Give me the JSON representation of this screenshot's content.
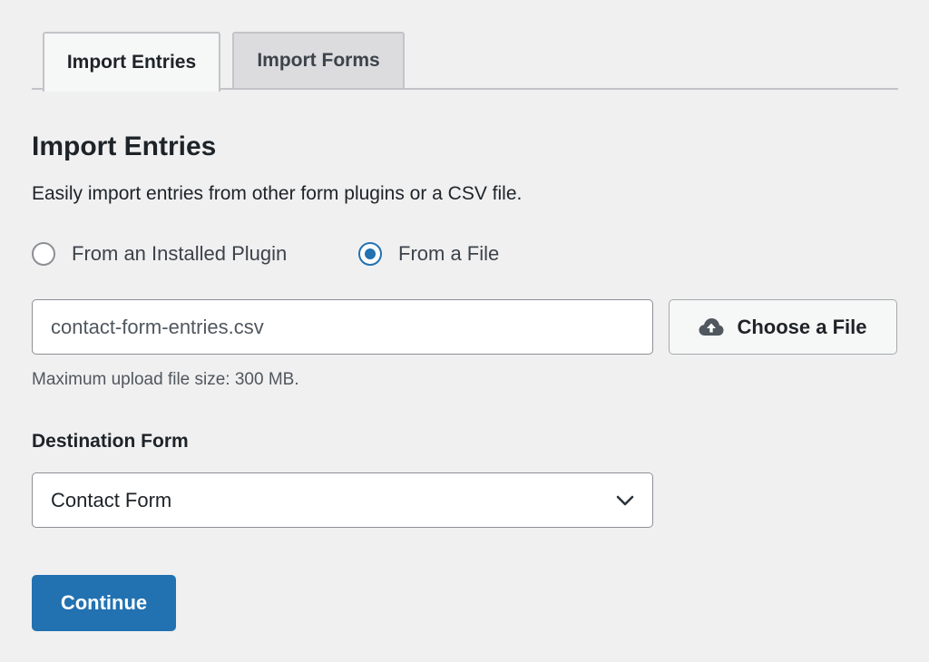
{
  "tabs": [
    {
      "label": "Import Entries",
      "active": true
    },
    {
      "label": "Import Forms",
      "active": false
    }
  ],
  "section": {
    "title": "Import Entries",
    "description": "Easily import entries from other form plugins or a CSV file."
  },
  "source_options": [
    {
      "label": "From an Installed Plugin",
      "selected": false
    },
    {
      "label": "From a File",
      "selected": true
    }
  ],
  "file_upload": {
    "value": "contact-form-entries.csv",
    "button_label": "Choose a File",
    "button_icon": "cloud-upload-icon",
    "help_text": "Maximum upload file size: 300 MB."
  },
  "destination": {
    "label": "Destination Form",
    "selected": "Contact Form",
    "icon": "chevron-down-icon"
  },
  "actions": {
    "continue_label": "Continue"
  },
  "colors": {
    "accent": "#2271b1",
    "background": "#f0f0f1",
    "text": "#1d2327",
    "muted_text": "#50575e"
  }
}
